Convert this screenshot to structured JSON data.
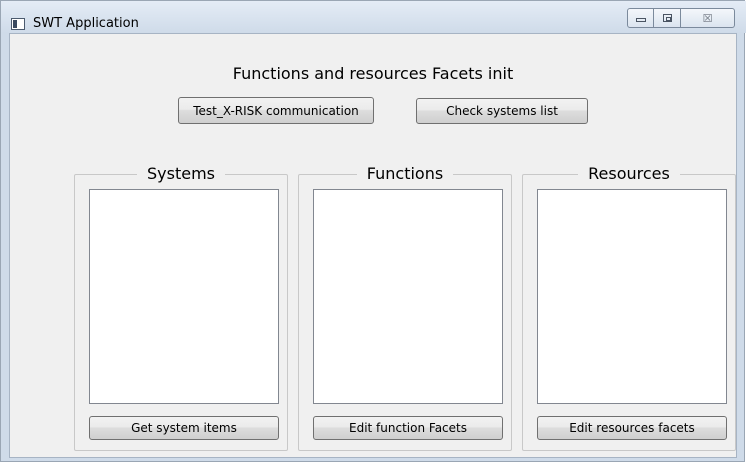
{
  "window": {
    "title": "SWT Application",
    "minimize_icon": "minimize-icon",
    "maximize_icon": "maximize-icon",
    "close_icon": "close-icon",
    "close_glyph": "☒"
  },
  "header": {
    "heading": "Functions and resources Facets init"
  },
  "toolbar": {
    "test_button_label": "Test_X-RISK communication",
    "check_button_label": "Check systems list"
  },
  "panels": [
    {
      "title": "Systems",
      "button_label": "Get system items"
    },
    {
      "title": "Functions",
      "button_label": "Edit function Facets"
    },
    {
      "title": "Resources",
      "button_label": "Edit resources facets"
    }
  ]
}
